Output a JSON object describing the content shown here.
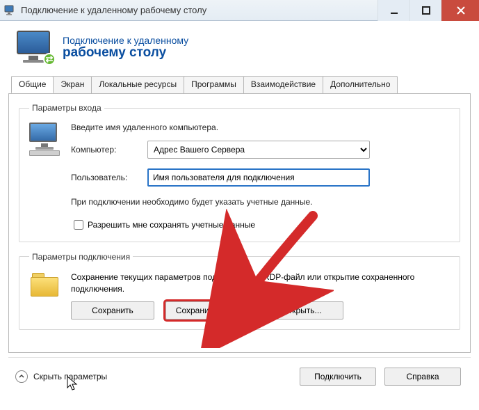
{
  "titlebar": {
    "title": "Подключение к удаленному рабочему столу"
  },
  "header": {
    "line1": "Подключение к удаленному",
    "line2": "рабочему столу"
  },
  "tabs": {
    "general": "Общие",
    "screen": "Экран",
    "local_resources": "Локальные ресурсы",
    "programs": "Программы",
    "interaction": "Взаимодействие",
    "advanced": "Дополнительно"
  },
  "login_group": {
    "legend": "Параметры входа",
    "intro": "Введите имя удаленного компьютера.",
    "computer_label": "Компьютер:",
    "computer_value": "Адрес Вашего Сервера",
    "user_label": "Пользователь:",
    "user_value": "Имя пользователя для подключения",
    "hint": "При подключении необходимо будет указать учетные данные.",
    "allow_save_label": "Разрешить мне сохранять учетные данные"
  },
  "conn_group": {
    "legend": "Параметры подключения",
    "text": "Сохранение текущих параметров подключения в RDP-файл или открытие сохраненного подключения.",
    "save": "Сохранить",
    "save_as": "Сохранить как...",
    "open": "Открыть..."
  },
  "bottom": {
    "hide_params": "Скрыть параметры",
    "connect": "Подключить",
    "help": "Справка"
  }
}
